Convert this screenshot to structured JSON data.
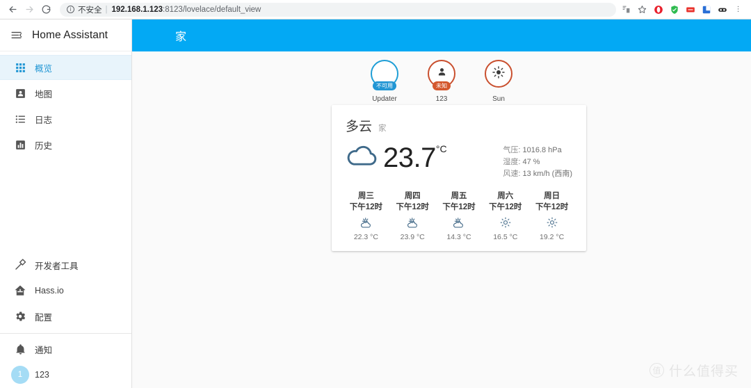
{
  "browser": {
    "back_icon": "arrow-left-icon",
    "forward_icon": "arrow-right-icon",
    "reload_icon": "reload-icon",
    "security_label": "不安全",
    "security_icon": "info-circle-icon",
    "url_host": "192.168.1.123",
    "url_path": ":8123/lovelace/default_view",
    "toolbar_icons": [
      {
        "name": "translate-icon",
        "glyph": "⇄",
        "color": "#5f6368"
      },
      {
        "name": "bookmark-star-icon",
        "glyph": "☆",
        "color": "#5f6368"
      },
      {
        "name": "extension-opera-icon",
        "color": "#e8202c"
      },
      {
        "name": "extension-shield-icon",
        "color": "#2fbb4f"
      },
      {
        "name": "extension-red-icon",
        "color": "#e8312b"
      },
      {
        "name": "extension-blue-icon",
        "color": "#2a6fd6"
      },
      {
        "name": "extension-dark-icon",
        "color": "#2b2b2b"
      }
    ]
  },
  "sidebar": {
    "menu_icon": "hamburger-collapse-icon",
    "title": "Home Assistant",
    "items": [
      {
        "label": "概览",
        "icon": "grid-dots-icon",
        "active": true
      },
      {
        "label": "地图",
        "icon": "map-person-icon",
        "active": false
      },
      {
        "label": "日志",
        "icon": "logbook-list-icon",
        "active": false
      },
      {
        "label": "历史",
        "icon": "history-chart-icon",
        "active": false
      }
    ],
    "bottom_items": [
      {
        "label": "开发者工具",
        "icon": "hammer-icon"
      },
      {
        "label": "Hass.io",
        "icon": "home-assistant-logo-icon"
      },
      {
        "label": "配置",
        "icon": "gear-icon"
      }
    ],
    "notification": {
      "label": "通知",
      "icon": "bell-icon"
    },
    "user": {
      "label": "123",
      "avatar_initial": "1",
      "avatar_color": "#a5dcf5"
    }
  },
  "appbar": {
    "title": "家",
    "background": "#03a9f4"
  },
  "badges": [
    {
      "name": "Updater",
      "value": "不可用",
      "ring_color": "#1e9ed6",
      "value_color": "#2196d4",
      "icon": "blank-icon"
    },
    {
      "name": "123",
      "value": "未知",
      "ring_color": "#c94f2e",
      "value_color": "#d4582e",
      "icon": "person-icon"
    },
    {
      "name": "Sun",
      "value": "",
      "ring_color": "#c94f2e",
      "value_color": "",
      "icon": "sun-icon"
    }
  ],
  "weather_card": {
    "condition": "多云",
    "location": "家",
    "condition_icon": "cloud-icon",
    "temperature": "23.7",
    "temperature_unit": "°C",
    "attributes": [
      {
        "key": "气压",
        "value": "1016.8 hPa"
      },
      {
        "key": "湿度",
        "value": "47 %"
      },
      {
        "key": "风速",
        "value": "13 km/h (西南)"
      }
    ],
    "forecast": [
      {
        "day": "周三",
        "time": "下午12时",
        "icon": "partly-cloudy-icon",
        "temp": "22.3 °C"
      },
      {
        "day": "周四",
        "time": "下午12时",
        "icon": "partly-cloudy-icon",
        "temp": "23.9 °C"
      },
      {
        "day": "周五",
        "time": "下午12时",
        "icon": "partly-cloudy-icon",
        "temp": "14.3 °C"
      },
      {
        "day": "周六",
        "time": "下午12时",
        "icon": "sunny-icon",
        "temp": "16.5 °C"
      },
      {
        "day": "周日",
        "time": "下午12时",
        "icon": "sunny-icon",
        "temp": "19.2 °C"
      }
    ]
  },
  "watermark": {
    "mark": "值",
    "text": "什么值得买"
  }
}
